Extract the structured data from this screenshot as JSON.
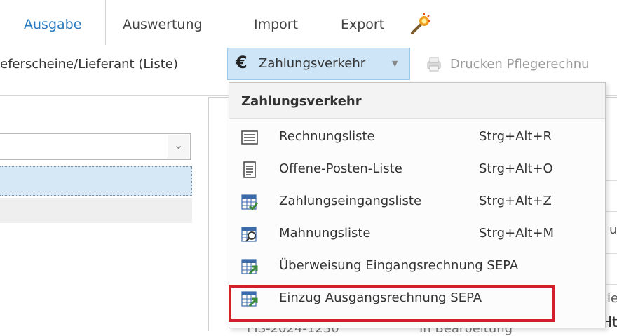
{
  "ribbon": {
    "tabs": [
      {
        "label": "Ausgabe",
        "active": true
      },
      {
        "label": "Auswertung"
      },
      {
        "label": "Import"
      },
      {
        "label": "Export"
      }
    ],
    "wizard_icon": "magic-wand-icon"
  },
  "toolbar": {
    "lieferscheine_label": "eferscheine/Lieferant (Liste)",
    "zahlungsverkehr_label": "Zahlungsverkehr",
    "zahlungsverkehr_icon": "euro-icon",
    "drucken_label": "Drucken Pflegerechnu",
    "drucken_icon": "print-care-invoice-icon"
  },
  "background": {
    "cut_text_a": "u",
    "cut_text_b": "ie",
    "cut_text_c": "Ht",
    "row_partial_id": "FIS-2024-1230",
    "row_partial_status": "In Bearbeitung"
  },
  "menu": {
    "header": "Zahlungsverkehr",
    "items": [
      {
        "label": "Rechnungsliste",
        "shortcut": "Strg+Alt+R",
        "icon": "list-lines-icon"
      },
      {
        "label": "Offene-Posten-Liste",
        "shortcut": "Strg+Alt+O",
        "icon": "document-list-icon"
      },
      {
        "label": "Zahlungseingangsliste",
        "shortcut": "Strg+Alt+Z",
        "icon": "table-check-icon"
      },
      {
        "label": "Mahnungsliste",
        "shortcut": "Strg+Alt+M",
        "icon": "table-search-icon"
      },
      {
        "label": "Überweisung Eingangsrechnung SEPA",
        "shortcut": "",
        "icon": "table-transfer-icon"
      },
      {
        "label": "Einzug Ausgangsrechnung SEPA",
        "shortcut": "",
        "icon": "table-collect-icon",
        "highlighted": true
      }
    ]
  },
  "colors": {
    "accent_blue": "#2a7bc0",
    "button_highlight": "#cde5f7",
    "highlight_border": "#d21f2b",
    "icon_green": "#3a8a3a"
  }
}
